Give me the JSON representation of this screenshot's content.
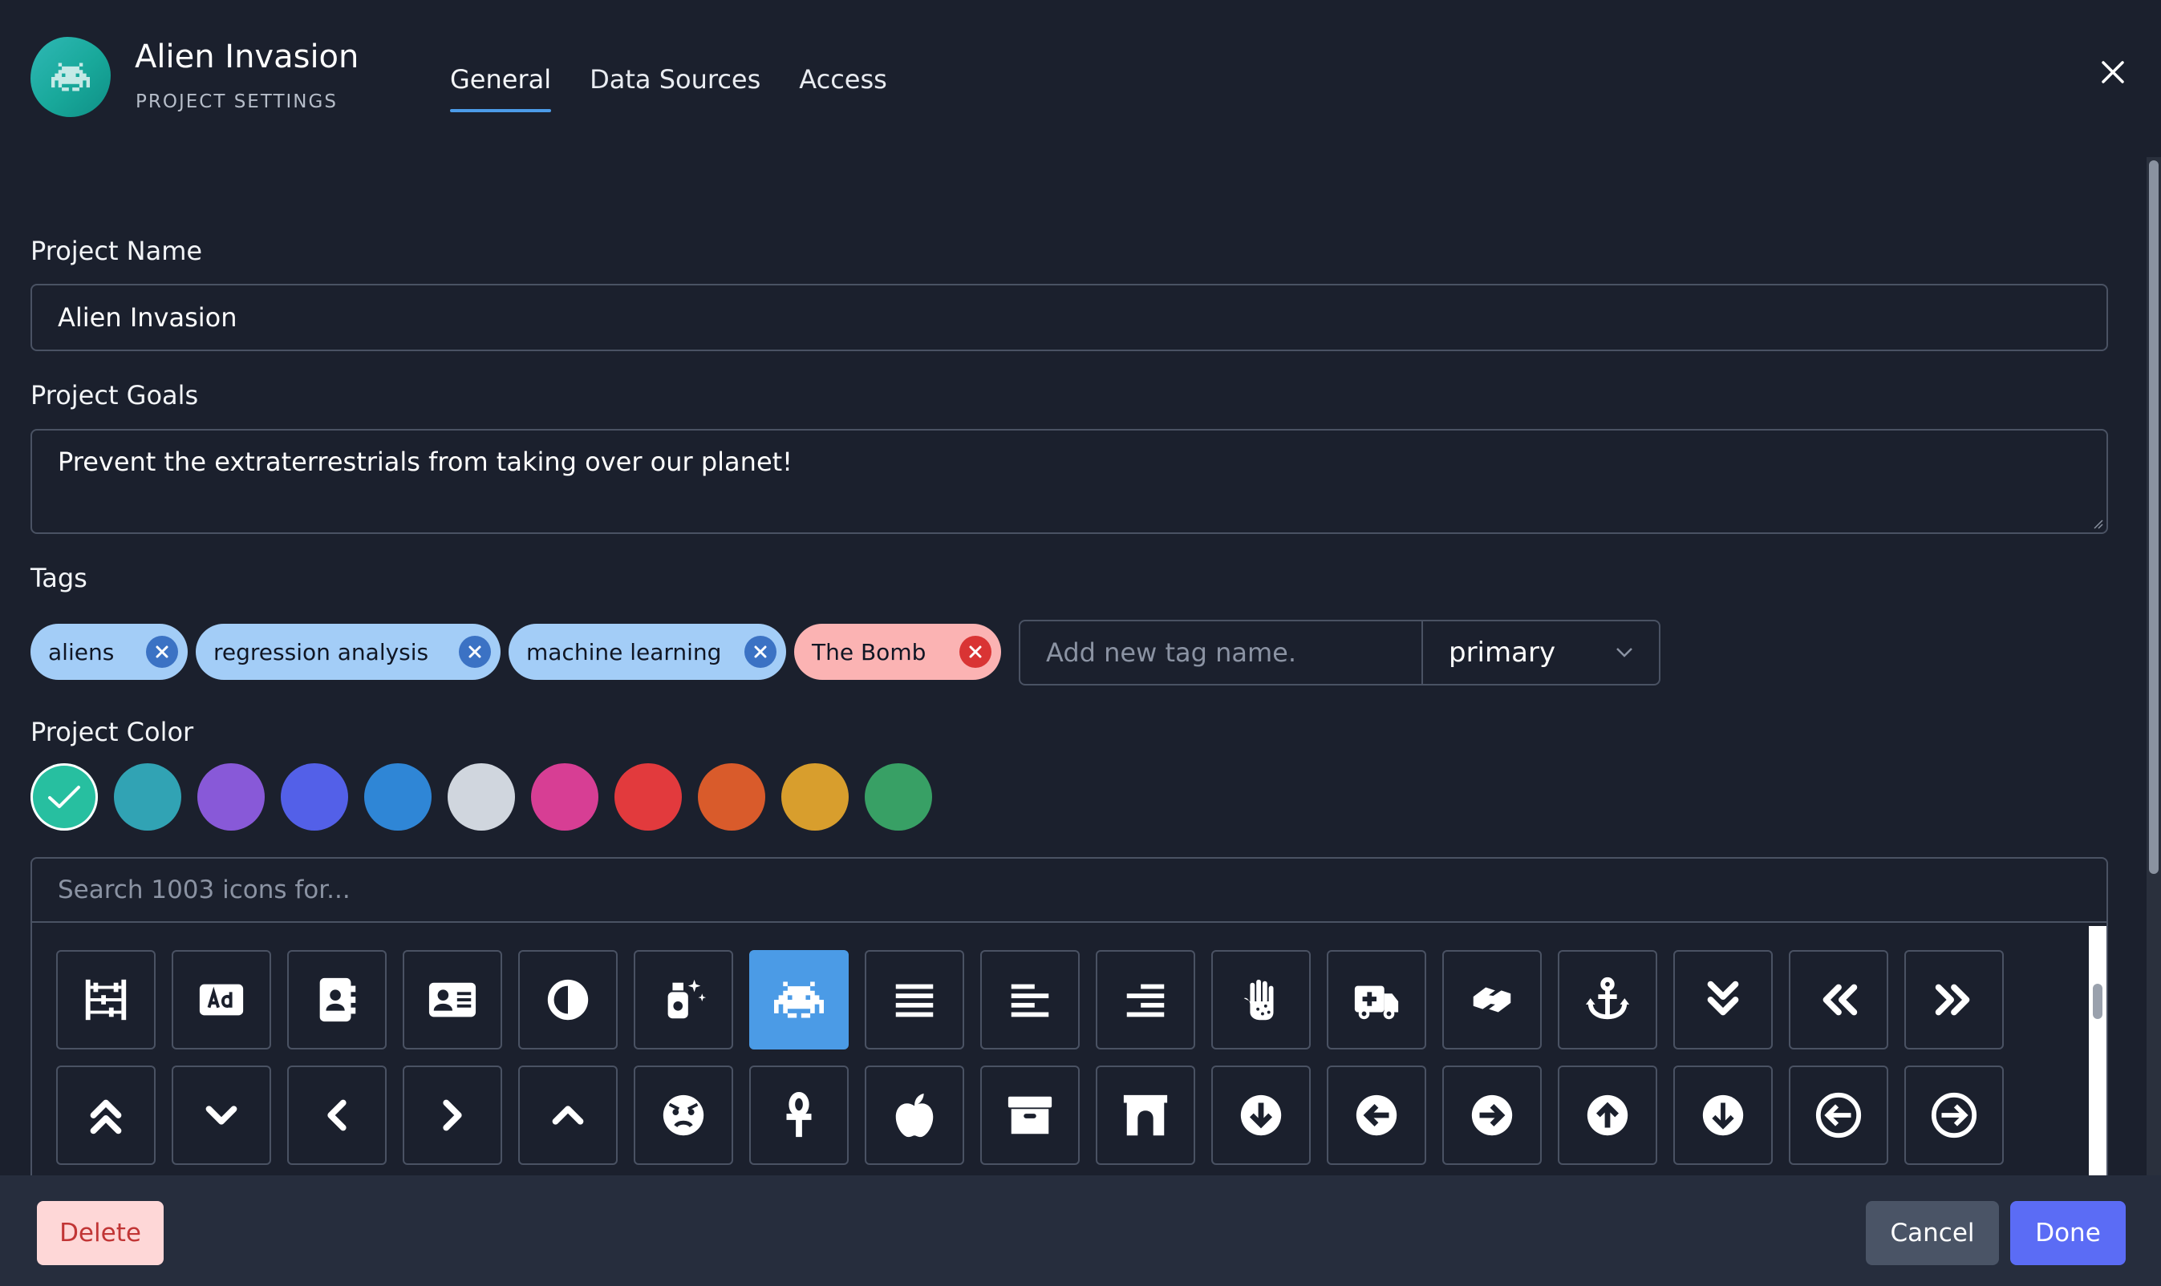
{
  "header": {
    "title": "Alien Invasion",
    "subtitle": "PROJECT SETTINGS",
    "tabs": [
      {
        "label": "General",
        "active": true
      },
      {
        "label": "Data Sources",
        "active": false
      },
      {
        "label": "Access",
        "active": false
      }
    ]
  },
  "form": {
    "name_label": "Project Name",
    "name_value": "Alien Invasion",
    "goals_label": "Project Goals",
    "goals_value": "Prevent the extraterrestrials from taking over our planet!",
    "tags_label": "Tags",
    "tags": [
      {
        "label": "aliens",
        "style": "primary"
      },
      {
        "label": "regression analysis",
        "style": "primary"
      },
      {
        "label": "machine learning",
        "style": "primary"
      },
      {
        "label": "The Bomb",
        "style": "danger"
      }
    ],
    "new_tag_placeholder": "Add new tag name.",
    "tag_type_value": "primary",
    "color_label": "Project Color",
    "colors": [
      "#27bfa0",
      "#31a3b4",
      "#8859d8",
      "#5360e8",
      "#2f86d6",
      "#d0d6de",
      "#d73e94",
      "#e23a3d",
      "#d95b2b",
      "#d89e2d",
      "#38a065"
    ],
    "selected_color": "#27bfa0",
    "icon_search_placeholder": "Search 1003 icons for..."
  },
  "icons": {
    "selected": "space-invader-icon",
    "row1": [
      "abacus-icon",
      "ad-icon",
      "address-book-icon",
      "address-card-icon",
      "adjust-icon",
      "air-freshener-icon",
      "space-invader-icon",
      "align-justify-icon",
      "align-left-icon",
      "align-right-icon",
      "allergies-icon",
      "ambulance-icon",
      "sign-language-icon",
      "anchor-icon",
      "angle-double-down-icon",
      "angle-double-left-icon",
      "angle-double-right-icon"
    ],
    "row2": [
      "angle-double-up-icon",
      "angle-down-icon",
      "angle-left-icon",
      "angle-right-icon",
      "angle-up-icon",
      "angry-icon",
      "ankh-icon",
      "apple-icon",
      "archive-icon",
      "archway-icon",
      "arrow-circle-down-icon",
      "arrow-circle-left-icon",
      "arrow-circle-right-icon",
      "arrow-circle-up-icon",
      "arrow-down-circle-icon",
      "arrow-left-circle-icon",
      "arrow-right-circle-icon"
    ]
  },
  "footer": {
    "delete_label": "Delete",
    "cancel_label": "Cancel",
    "done_label": "Done"
  }
}
